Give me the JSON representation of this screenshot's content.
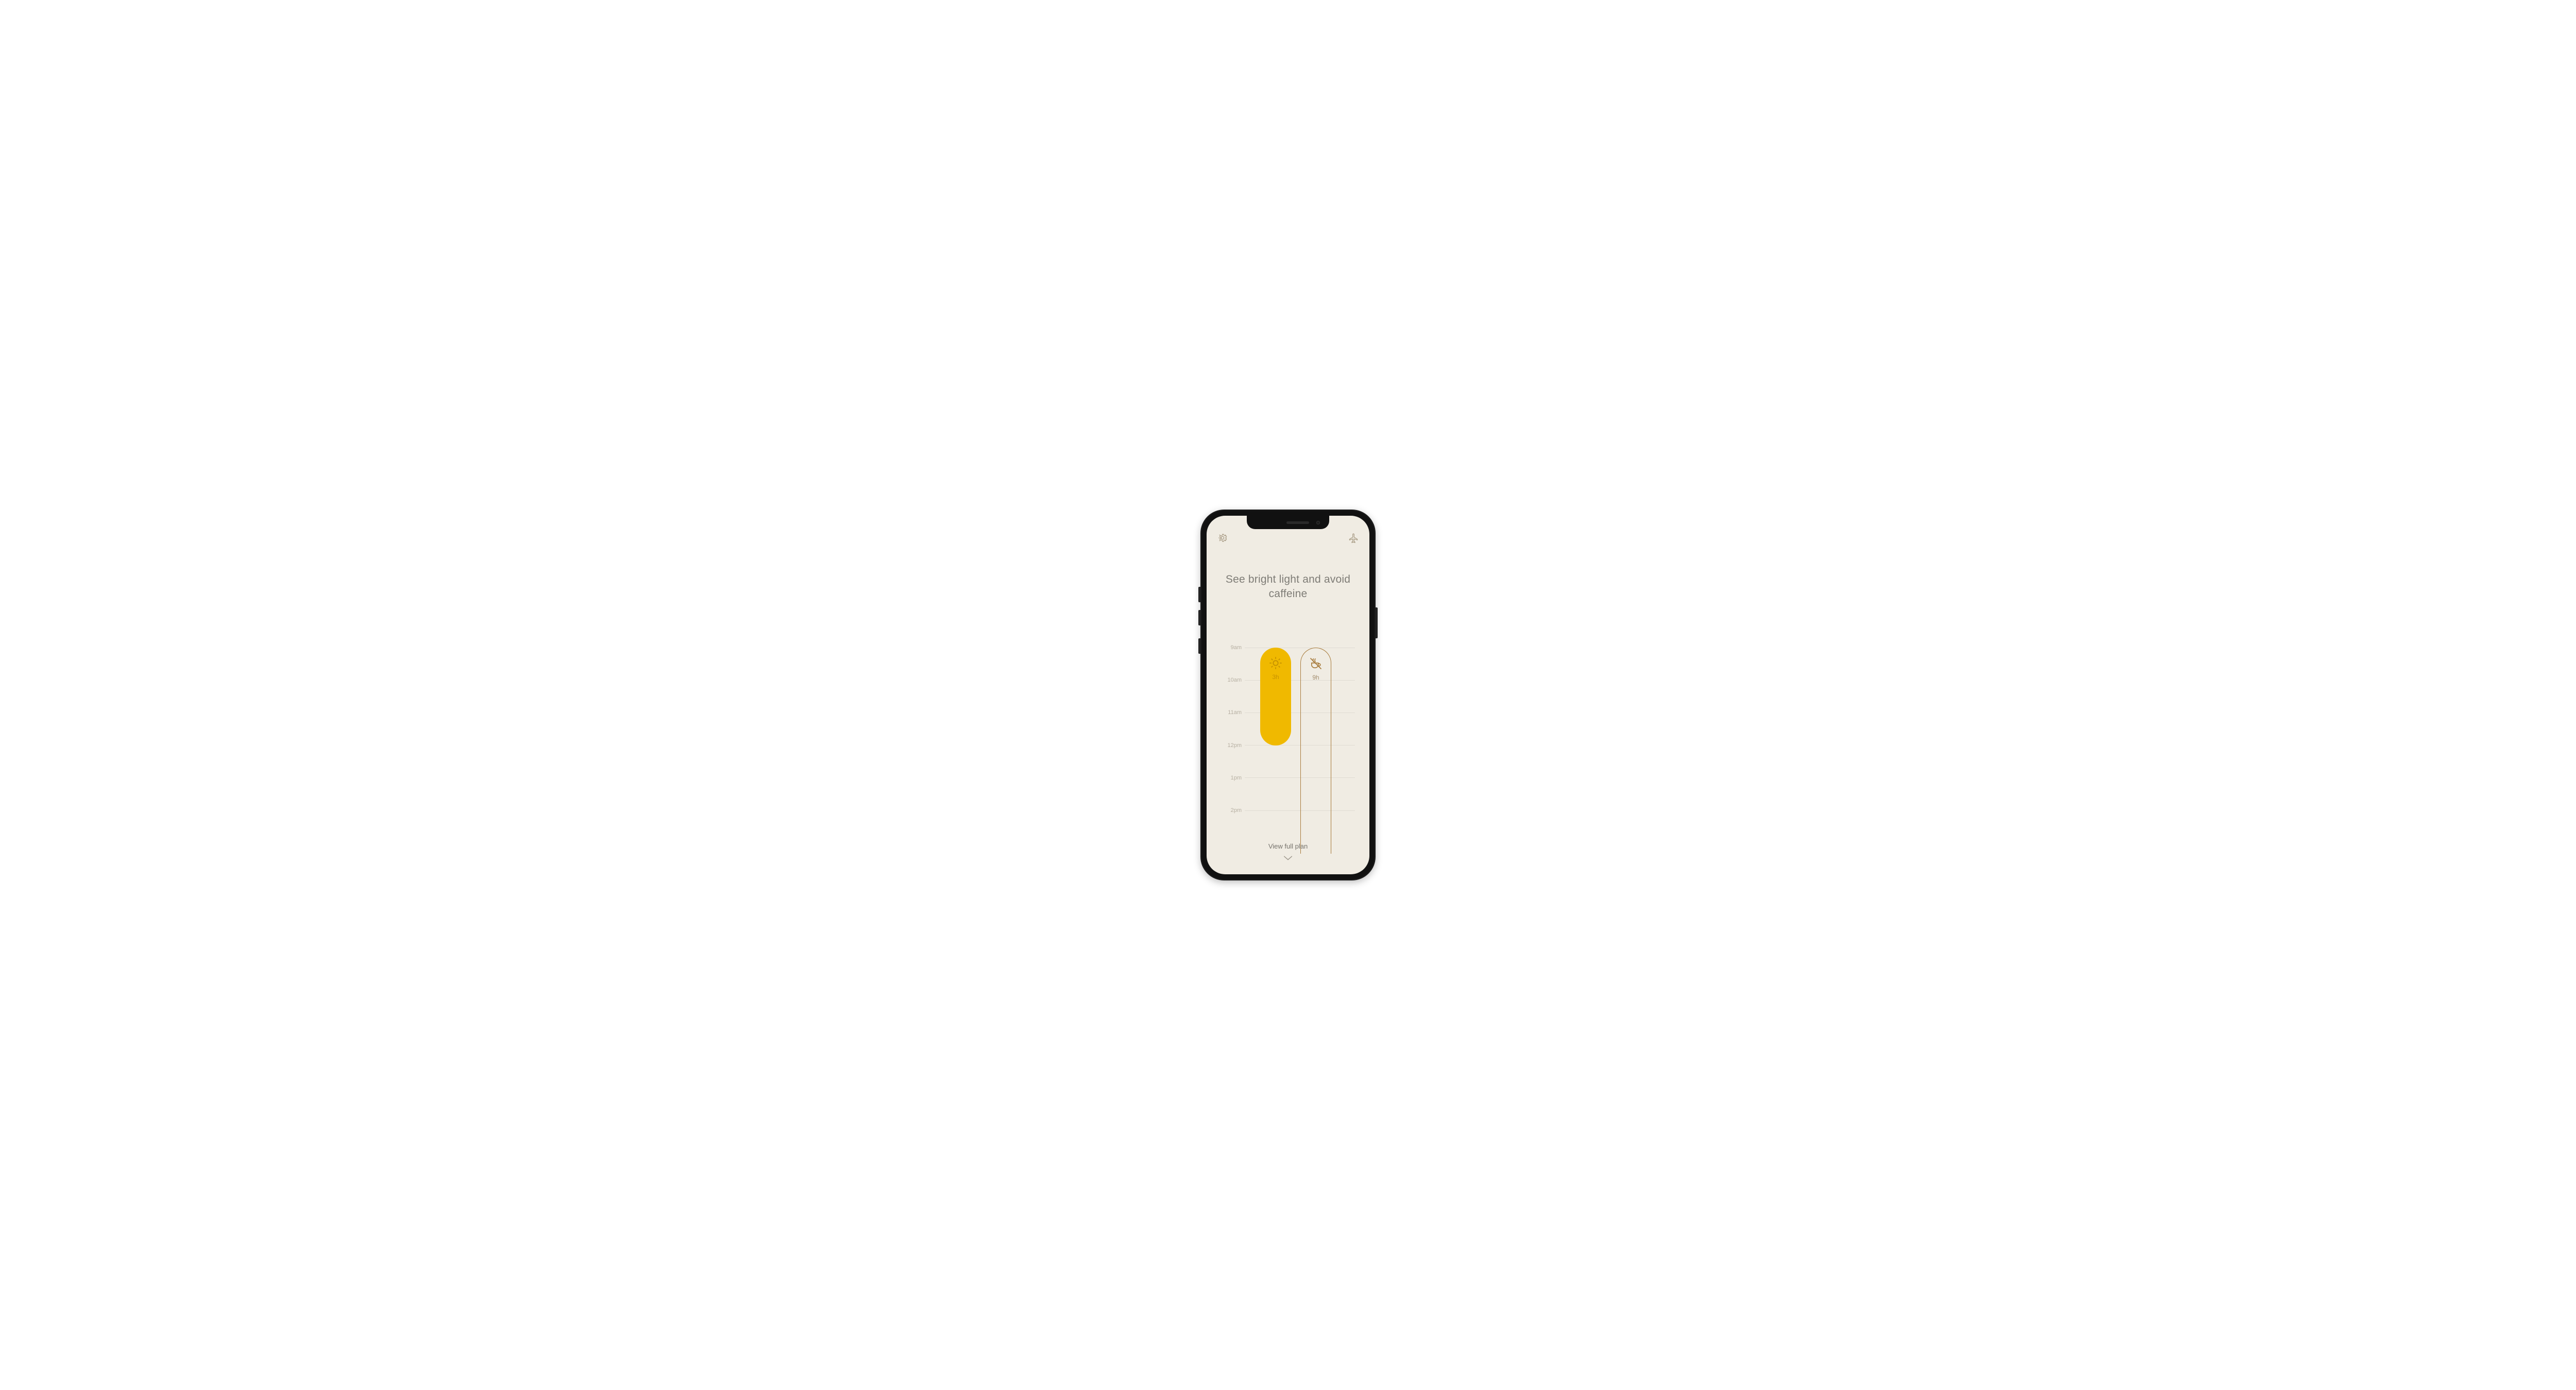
{
  "header": {
    "settings_icon": "gear-icon",
    "travel_icon": "airplane-icon"
  },
  "headline": "See bright light and avoid caffeine",
  "timeline": {
    "hours": [
      "9am",
      "10am",
      "11am",
      "12pm",
      "1pm",
      "2pm"
    ],
    "events": [
      {
        "id": "light",
        "icon": "sun-icon",
        "duration_label": "3h"
      },
      {
        "id": "caffeine",
        "icon": "no-coffee-icon",
        "duration_label": "9h"
      }
    ]
  },
  "footer": {
    "view_full_plan_label": "View full plan",
    "chevron_icon": "chevron-down-icon"
  },
  "colors": {
    "background": "#f0ece3",
    "accent_yellow": "#f0b900",
    "outline_brown": "#a77a3a",
    "text_muted": "#7e7c76"
  }
}
